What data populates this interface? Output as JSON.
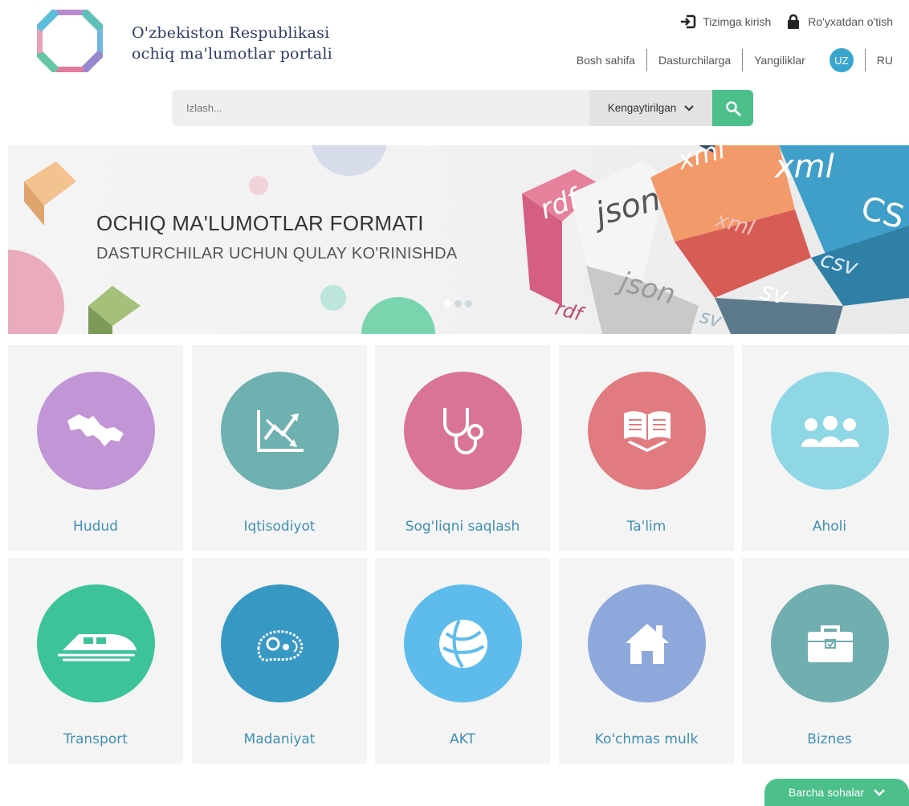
{
  "header": {
    "title_line1": "O'zbekiston Respublikasi",
    "title_line2": "ochiq ma'lumotlar portali",
    "login": "Tizimga kirish",
    "register": "Ro'yxatdan o'tish",
    "nav": [
      "Bosh sahifa",
      "Dasturchilarga",
      "Yangiliklar"
    ],
    "lang_active": "UZ",
    "lang_other": "RU"
  },
  "search": {
    "placeholder": "Izlash...",
    "advanced_label": "Kengaytirilgan"
  },
  "banner": {
    "heading": "OCHIQ MA'LUMOTLAR FORMATI",
    "subheading": "DASTURCHILAR UCHUN QULAY KO'RINISHDA",
    "formats": [
      "rdf",
      "json",
      "xml",
      "xml",
      "CS",
      "csv",
      "json",
      "sv",
      "rdf",
      "sv"
    ],
    "slides_total": 3,
    "slide_active": 1
  },
  "categories": [
    {
      "label": "Hudud",
      "icon": "map-icon",
      "color": "#c195d6"
    },
    {
      "label": "Iqtisodiyot",
      "icon": "chart-trend-icon",
      "color": "#6fb0b0"
    },
    {
      "label": "Sog'liqni saqlash",
      "icon": "stethoscope-icon",
      "color": "#d97496"
    },
    {
      "label": "Ta'lim",
      "icon": "open-book-icon",
      "color": "#e17b7f"
    },
    {
      "label": "Aholi",
      "icon": "people-icon",
      "color": "#8fd7e4"
    },
    {
      "label": "Transport",
      "icon": "train-icon",
      "color": "#3cc39a"
    },
    {
      "label": "Madaniyat",
      "icon": "paisley-icon",
      "color": "#3798c4"
    },
    {
      "label": "AKT",
      "icon": "globe-network-icon",
      "color": "#5ebcec"
    },
    {
      "label": "Ko'chmas mulk",
      "icon": "house-icon",
      "color": "#8ea8dc"
    },
    {
      "label": "Biznes",
      "icon": "briefcase-icon",
      "color": "#71aeb0"
    }
  ],
  "all_button": "Barcha sohalar"
}
